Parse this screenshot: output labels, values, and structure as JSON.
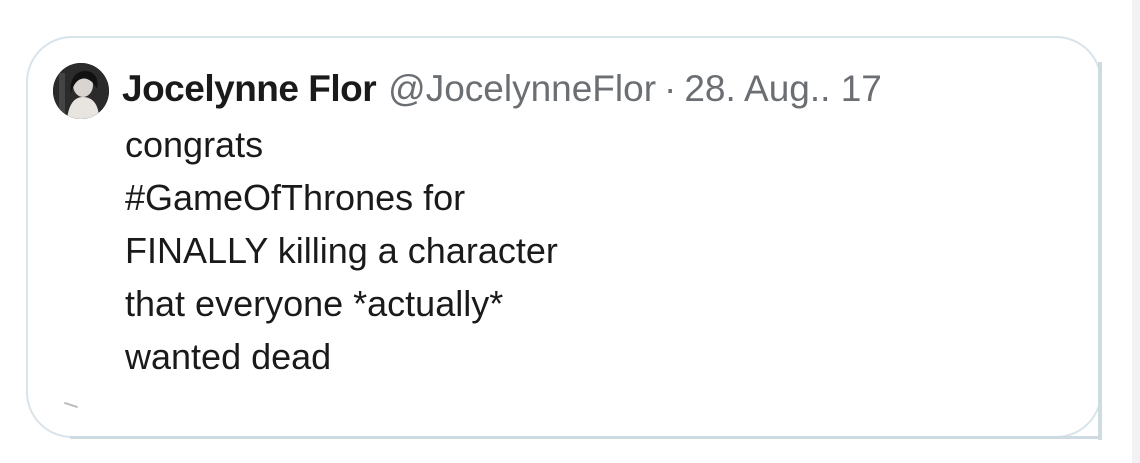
{
  "tweet": {
    "author_name": "Jocelynne Flor",
    "author_handle": "@JocelynneFlor",
    "separator": "·",
    "date": "28. Aug.. 17",
    "lines": [
      "congrats",
      "#GameOfThrones for",
      "FINALLY killing a character",
      "that everyone *actually*",
      "wanted dead"
    ],
    "avatar_icon": "profile-photo"
  },
  "colors": {
    "text_primary": "#1a1a1a",
    "text_secondary": "#6b6f73",
    "card_border": "#d8e3ea"
  }
}
